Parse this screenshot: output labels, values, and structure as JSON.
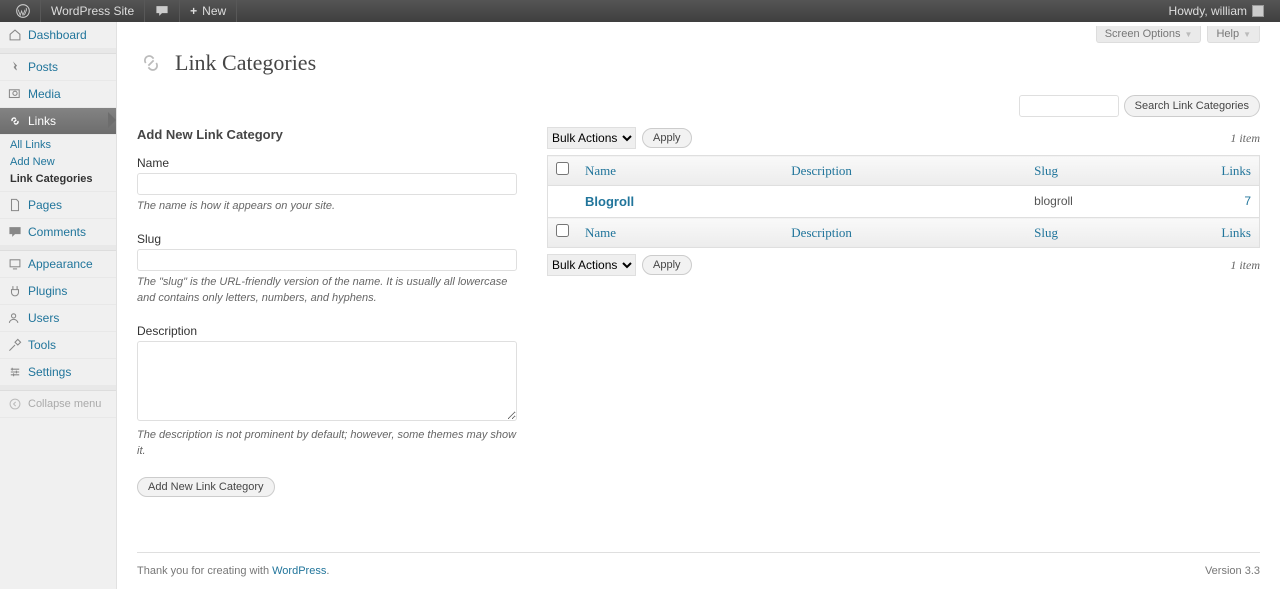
{
  "adminbar": {
    "site_name": "WordPress Site",
    "new_label": "New",
    "howdy": "Howdy, william"
  },
  "screen_options": "Screen Options",
  "help": "Help",
  "page_title": "Link Categories",
  "search": {
    "placeholder": "",
    "button": "Search Link Categories"
  },
  "sidebar": {
    "dashboard": "Dashboard",
    "posts": "Posts",
    "media": "Media",
    "links": "Links",
    "pages": "Pages",
    "comments": "Comments",
    "appearance": "Appearance",
    "plugins": "Plugins",
    "users": "Users",
    "tools": "Tools",
    "settings": "Settings",
    "collapse": "Collapse menu",
    "sub": {
      "all_links": "All Links",
      "add_new": "Add New",
      "link_categories": "Link Categories"
    }
  },
  "form": {
    "heading": "Add New Link Category",
    "name_label": "Name",
    "name_hint": "The name is how it appears on your site.",
    "slug_label": "Slug",
    "slug_hint": "The \"slug\" is the URL-friendly version of the name. It is usually all lowercase and contains only letters, numbers, and hyphens.",
    "desc_label": "Description",
    "desc_hint": "The description is not prominent by default; however, some themes may show it.",
    "submit": "Add New Link Category"
  },
  "bulk": {
    "label": "Bulk Actions",
    "apply": "Apply"
  },
  "item_count": "1 item",
  "table": {
    "headers": {
      "name": "Name",
      "description": "Description",
      "slug": "Slug",
      "links": "Links"
    },
    "rows": [
      {
        "name": "Blogroll",
        "description": "",
        "slug": "blogroll",
        "links": "7"
      }
    ]
  },
  "footer": {
    "thanks_prefix": "Thank you for creating with ",
    "thanks_link": "WordPress",
    "version": "Version 3.3"
  }
}
